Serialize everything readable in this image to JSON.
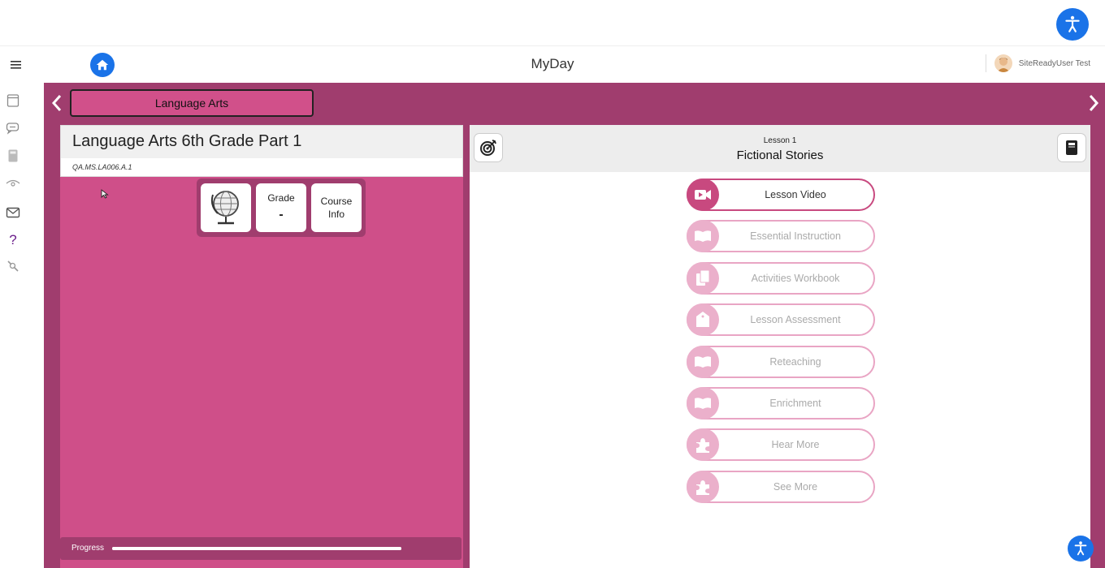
{
  "header": {
    "app_title": "MyDay",
    "user_name": "SiteReadyUser Test"
  },
  "subject_tab": {
    "label": "Language Arts"
  },
  "course": {
    "title": "Language Arts 6th Grade Part 1",
    "code": "QA.MS.LA006.A.1",
    "grade_label": "Grade",
    "grade_value": "-",
    "info_label_line1": "Course",
    "info_label_line2": "Info"
  },
  "progress": {
    "label": "Progress",
    "fraction": 1.0
  },
  "lesson": {
    "number_label": "Lesson 1",
    "title": "Fictional Stories",
    "items": [
      {
        "label": "Lesson Video",
        "icon": "video-icon",
        "active": true
      },
      {
        "label": "Essential Instruction",
        "icon": "book-icon",
        "active": false
      },
      {
        "label": "Activities Workbook",
        "icon": "pages-icon",
        "active": false
      },
      {
        "label": "Lesson Assessment",
        "icon": "tag-check-icon",
        "active": false
      },
      {
        "label": "Reteaching",
        "icon": "book-icon",
        "active": false
      },
      {
        "label": "Enrichment",
        "icon": "book-icon",
        "active": false
      },
      {
        "label": "Hear More",
        "icon": "puzzle-icon",
        "active": false
      },
      {
        "label": "See More",
        "icon": "puzzle-icon",
        "active": false
      }
    ]
  },
  "colors": {
    "stage": "#a03d6e",
    "panel": "#cf4f89",
    "accent_blue": "#1a73e8",
    "active_icon": "#c8497f",
    "inactive_icon": "#ebb0cb"
  }
}
